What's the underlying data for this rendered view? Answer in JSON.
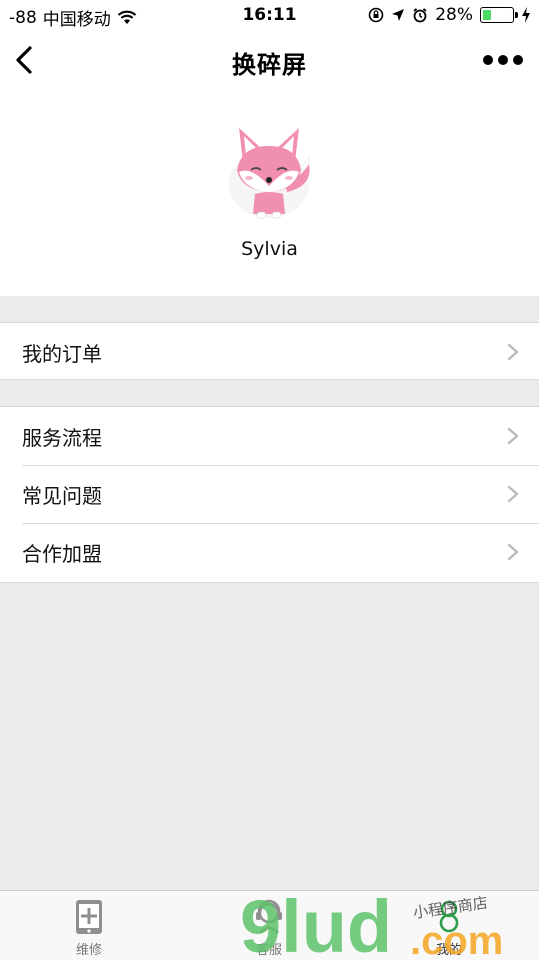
{
  "status_bar": {
    "signal": "-88",
    "carrier": "中国移动",
    "time": "16:11",
    "battery_percent": "28%",
    "battery_level": 0.28,
    "icons": [
      "wifi-icon",
      "orientation-lock-icon",
      "location-icon",
      "alarm-icon",
      "battery-icon",
      "charging-icon"
    ]
  },
  "nav": {
    "title": "换碎屏",
    "back_icon": "chevron-left-icon",
    "more_icon": "more-dots-icon"
  },
  "profile": {
    "username": "Sylvia",
    "avatar_icon": "fox-avatar"
  },
  "menu_group_1": [
    {
      "label": "我的订单"
    }
  ],
  "menu_group_2": [
    {
      "label": "服务流程"
    },
    {
      "label": "常见问题"
    },
    {
      "label": "合作加盟"
    }
  ],
  "tab_bar": {
    "tabs": [
      {
        "label": "维修",
        "icon": "phone-repair-icon"
      },
      {
        "label": "客服",
        "icon": "customer-service-icon"
      },
      {
        "label": "我的",
        "icon": "profile-icon",
        "active": true
      }
    ]
  },
  "watermark": {
    "text": "9lud.com",
    "subtext": "小程序商店"
  },
  "colors": {
    "background": "#ebebeb",
    "accent_green": "#3cb371",
    "watermark_green": "#5ec26a",
    "watermark_orange": "#f5a623"
  }
}
